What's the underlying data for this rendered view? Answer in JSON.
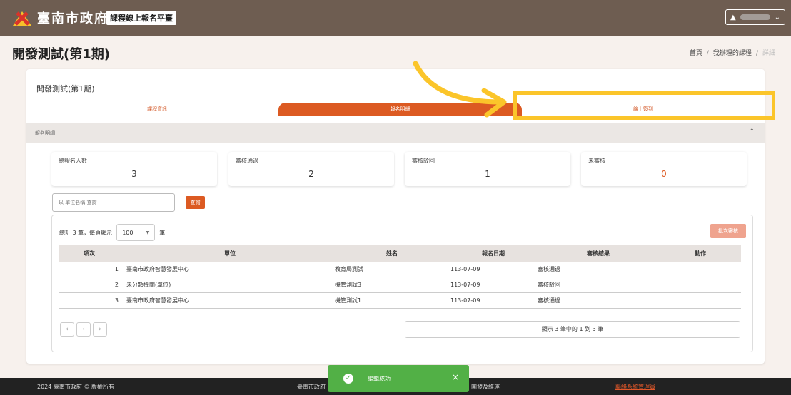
{
  "header": {
    "gov_name": "臺南市政府",
    "platform": "課程線上報名平臺",
    "user_icon": "user-icon",
    "user_caret": "⌄"
  },
  "page": {
    "title": "開發測試(第1期)",
    "breadcrumb": [
      "首頁",
      "我辦理的課程",
      "詳細"
    ]
  },
  "card": {
    "title": "開發測試(第1期)",
    "tabs": [
      "課程資訊",
      "報名明細",
      "線上簽到"
    ],
    "active_tab": 1,
    "section_title": "報名明細",
    "section_chevron": "^"
  },
  "stats": [
    {
      "label": "總報名人數",
      "value": "3"
    },
    {
      "label": "審核通過",
      "value": "2"
    },
    {
      "label": "審核駁回",
      "value": "1"
    },
    {
      "label": "未審核",
      "value": "0"
    }
  ],
  "search": {
    "placeholder": "以 單位名稱 查詢",
    "button": "查詢"
  },
  "list": {
    "count_prefix": "總計 3 筆，每頁顯示",
    "page_size": "100",
    "count_suffix": "筆",
    "batch_button": "批次審核",
    "columns": [
      "項次",
      "單位",
      "姓名",
      "報名日期",
      "審核結果",
      "動作"
    ],
    "rows": [
      {
        "idx": "1",
        "unit": "臺南市政府智慧發展中心",
        "name": "教育局測試",
        "date": "113-07-09",
        "result": "審核通過",
        "action": ""
      },
      {
        "idx": "2",
        "unit": "未分類機關(單位)",
        "name": "機管測試3",
        "date": "113-07-09",
        "result": "審核駁回",
        "action": ""
      },
      {
        "idx": "3",
        "unit": "臺南市政府智慧發展中心",
        "name": "機管測試1",
        "date": "113-07-09",
        "result": "審核通過",
        "action": ""
      }
    ],
    "pager": [
      "‹",
      "‹",
      "›"
    ],
    "page_info": "顯示 3 筆中的 1 到 3 筆"
  },
  "footer": {
    "copyright": "2024 臺南市政府 © 版權所有",
    "center_left": "臺南市政府",
    "center_right": "開發及維運",
    "contact": "聯絡系統管理員"
  },
  "toast": {
    "message": "編輯成功",
    "close": "×"
  },
  "colors": {
    "header": "#6e5d51",
    "accent": "#dc5a22",
    "toast": "#52b046",
    "annotation": "#fbc52a"
  }
}
